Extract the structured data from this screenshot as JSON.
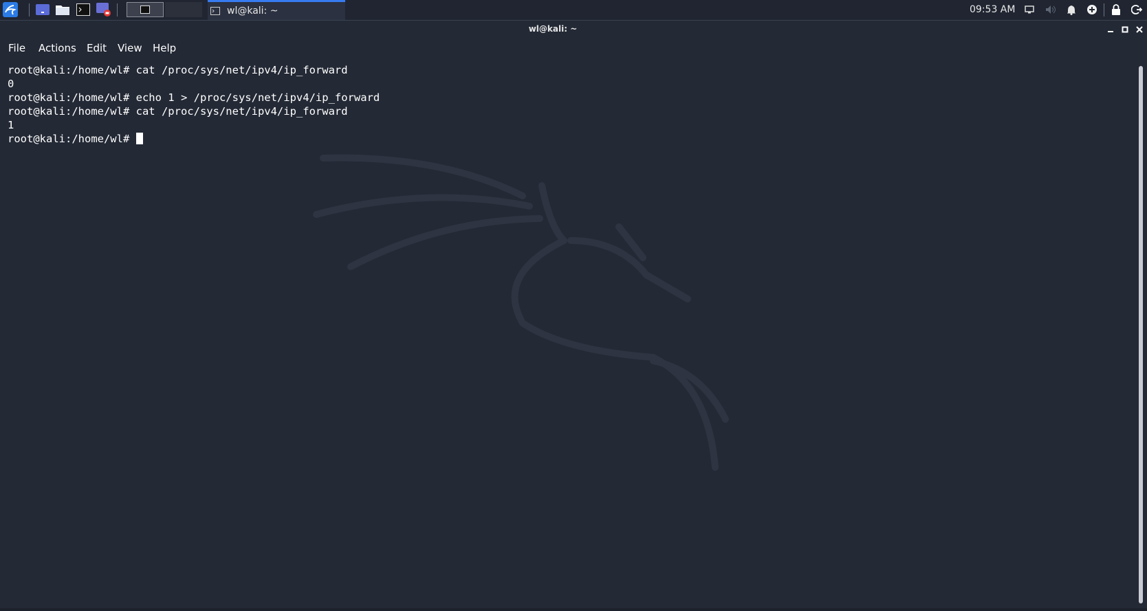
{
  "panel": {
    "launchers": [
      "kali-menu-icon",
      "desktop-icon",
      "file-manager-icon",
      "terminal-icon",
      "screen-recorder-icon"
    ],
    "workspaces": [
      "1",
      "2"
    ],
    "task": {
      "label": "wl@kali: ~",
      "icon": "terminal-icon"
    },
    "clock": "09:53 AM",
    "tray": [
      "display-icon",
      "volume-icon",
      "notification-bell-icon",
      "network-icon",
      "lock-icon",
      "logout-icon"
    ]
  },
  "window": {
    "title": "wl@kali: ~",
    "menu": [
      "File",
      "Actions",
      "Edit",
      "View",
      "Help"
    ]
  },
  "terminal": {
    "lines": [
      "root@kali:/home/wl# cat /proc/sys/net/ipv4/ip_forward",
      "0",
      "root@kali:/home/wl# echo 1 > /proc/sys/net/ipv4/ip_forward",
      "root@kali:/home/wl# cat /proc/sys/net/ipv4/ip_forward",
      "1",
      "root@kali:/home/wl# "
    ]
  },
  "colors": {
    "background": "#232935",
    "panel": "#202531",
    "accent": "#367bf0",
    "text": "#ffffff"
  }
}
